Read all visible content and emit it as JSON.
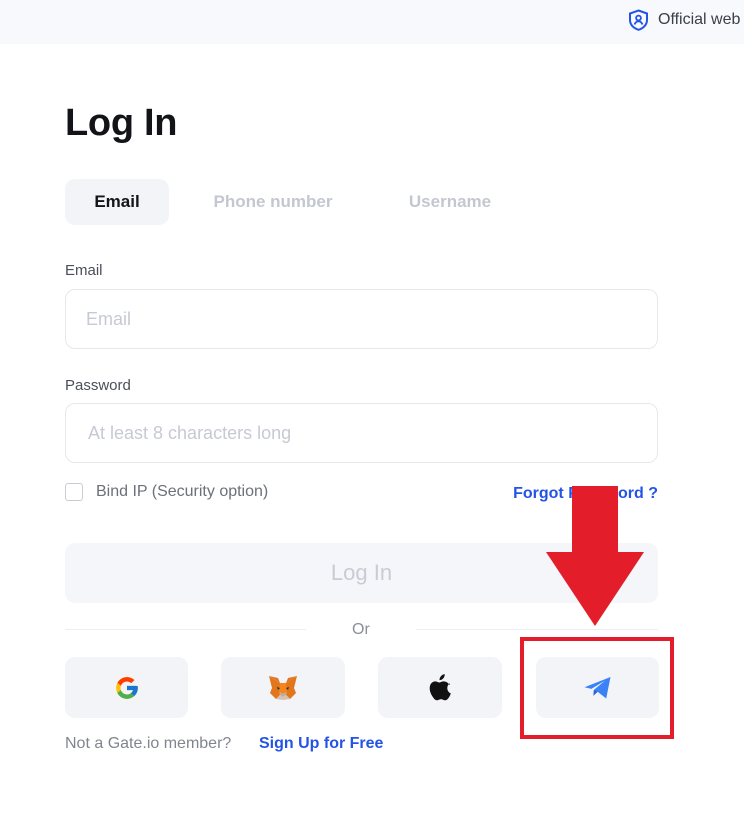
{
  "header": {
    "official_text": "Official web"
  },
  "page": {
    "title": "Log In"
  },
  "tabs": [
    {
      "label": "Email",
      "active": true
    },
    {
      "label": "Phone number",
      "active": false
    },
    {
      "label": "Username",
      "active": false
    }
  ],
  "form": {
    "email_label": "Email",
    "email_placeholder": "Email",
    "email_value": "",
    "password_label": "Password",
    "password_placeholder": "At least 8 characters long",
    "password_value": "",
    "bind_ip_label": "Bind IP (Security option)",
    "bind_ip_checked": false,
    "forgot_label": "Forgot Password ?",
    "submit_label": "Log In"
  },
  "divider": {
    "text": "Or"
  },
  "social": [
    {
      "name": "google",
      "icon": "google-icon"
    },
    {
      "name": "metamask",
      "icon": "metamask-fox-icon"
    },
    {
      "name": "apple",
      "icon": "apple-icon"
    },
    {
      "name": "telegram",
      "icon": "telegram-icon"
    }
  ],
  "footer": {
    "prompt": "Not a Gate.io member?",
    "signup_label": "Sign Up for Free"
  },
  "colors": {
    "accent": "#2354e6",
    "annotation": "#e31d2a",
    "telegram": "#3b82f6"
  }
}
